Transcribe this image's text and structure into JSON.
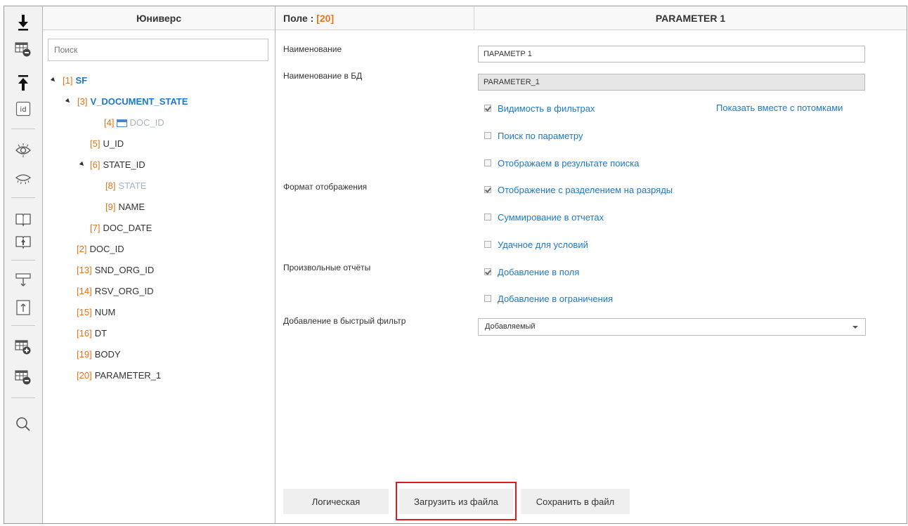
{
  "tree_panel": {
    "title": "Юниверс",
    "search_placeholder": "Поиск",
    "nodes": [
      {
        "num": "[1]",
        "label": "SF"
      },
      {
        "num": "[3]",
        "label": "V_DOCUMENT_STATE"
      },
      {
        "num": "[4]",
        "label": "DOC_ID"
      },
      {
        "num": "[5]",
        "label": "U_ID"
      },
      {
        "num": "[6]",
        "label": "STATE_ID"
      },
      {
        "num": "[8]",
        "label": "STATE"
      },
      {
        "num": "[9]",
        "label": "NAME"
      },
      {
        "num": "[7]",
        "label": "DOC_DATE"
      },
      {
        "num": "[2]",
        "label": "DOC_ID"
      },
      {
        "num": "[13]",
        "label": "SND_ORG_ID"
      },
      {
        "num": "[14]",
        "label": "RSV_ORG_ID"
      },
      {
        "num": "[15]",
        "label": "NUM"
      },
      {
        "num": "[16]",
        "label": "DT"
      },
      {
        "num": "[19]",
        "label": "BODY"
      },
      {
        "num": "[20]",
        "label": "PARAMETER_1"
      }
    ]
  },
  "properties": {
    "field_label": "Поле :",
    "field_num": "[20]",
    "title": "PARAMETER 1",
    "name_label": "Наименование",
    "name_value": "ПАРАМЕТР 1",
    "db_name_label": "Наименование в БД",
    "db_name_value": "PARAMETER_1",
    "display_format_label": "Формат отображения",
    "custom_reports_label": "Произвольные отчёты",
    "quick_filter_label": "Добавление в быстрый фильтр",
    "quick_filter_value": "Добавляемый",
    "show_with_descendants": "Показать вместе с потомками",
    "checkboxes": [
      {
        "label": "Видимость в фильтрах",
        "checked": true
      },
      {
        "label": "Поиск по параметру",
        "checked": false
      },
      {
        "label": "Отображаем в результате поиска",
        "checked": false
      },
      {
        "label": "Отображение с разделением на разряды",
        "checked": true
      },
      {
        "label": "Суммирование в отчетах",
        "checked": false
      },
      {
        "label": "Удачное для условий",
        "checked": false
      },
      {
        "label": "Добавление в поля",
        "checked": true
      },
      {
        "label": "Добавление в ограничения",
        "checked": false
      }
    ]
  },
  "buttons": {
    "logical": "Логическая",
    "load_from_file": "Загрузить из файла",
    "save_to_file": "Сохранить в файл"
  },
  "toolbar_icons": [
    "download-icon",
    "table-remove-icon",
    "upload-icon",
    "id-icon",
    "eye-show-icon",
    "eye-hide-icon",
    "book-icon",
    "book-upload-icon",
    "collapse-down-icon",
    "expand-up-icon",
    "table-add-icon",
    "table-remove-icon",
    "search-icon"
  ],
  "colors": {
    "accent": "#1e78c8",
    "number": "#e8731a",
    "highlight": "#e01b1b"
  }
}
